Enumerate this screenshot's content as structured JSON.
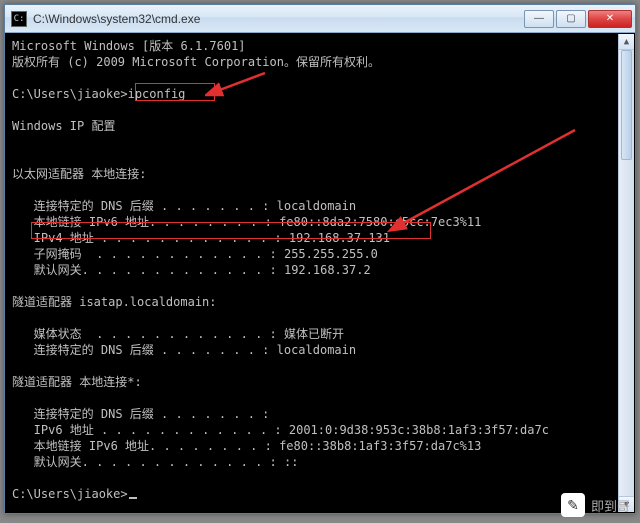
{
  "window": {
    "title": "C:\\Windows\\system32\\cmd.exe"
  },
  "header": {
    "line1": "Microsoft Windows [版本 6.1.7601]",
    "line2": "版权所有 (c) 2009 Microsoft Corporation。保留所有权利。"
  },
  "prompt1": {
    "path": "C:\\Users\\jiaoke>",
    "command": "ipconfig"
  },
  "output": {
    "heading": "Windows IP 配置",
    "sections": [
      {
        "title": "以太网适配器 本地连接:",
        "rows": [
          {
            "label": "   连接特定的 DNS 后缀 . . . . . . . :",
            "value": " localdomain"
          },
          {
            "label": "   本地链接 IPv6 地址. . . . . . . . :",
            "value": " fe80::8da2:7580:c5cc:7ec3%11"
          },
          {
            "label": "   IPv4 地址 . . . . . . . . . . . . :",
            "value": " 192.168.37.131"
          },
          {
            "label": "   子网掩码  . . . . . . . . . . . . :",
            "value": " 255.255.255.0"
          },
          {
            "label": "   默认网关. . . . . . . . . . . . . :",
            "value": " 192.168.37.2"
          }
        ]
      },
      {
        "title": "隧道适配器 isatap.localdomain:",
        "rows": [
          {
            "label": "   媒体状态  . . . . . . . . . . . . :",
            "value": " 媒体已断开"
          },
          {
            "label": "   连接特定的 DNS 后缀 . . . . . . . :",
            "value": " localdomain"
          }
        ]
      },
      {
        "title": "隧道适配器 本地连接*:",
        "rows": [
          {
            "label": "   连接特定的 DNS 后缀 . . . . . . . :",
            "value": ""
          },
          {
            "label": "   IPv6 地址 . . . . . . . . . . . . :",
            "value": " 2001:0:9d38:953c:38b8:1af3:3f57:da7c"
          },
          {
            "label": "   本地链接 IPv6 地址. . . . . . . . :",
            "value": " fe80::38b8:1af3:3f57:da7c%13"
          },
          {
            "label": "   默认网关. . . . . . . . . . . . . :",
            "value": " ::"
          }
        ]
      }
    ]
  },
  "prompt2": {
    "path": "C:\\Users\\jiaoke>"
  },
  "watermark": {
    "text": "即到哥"
  },
  "annotations": {
    "highlight_command": "ipconfig",
    "highlight_ipv4": "IPv4 地址 : 192.168.37.131"
  }
}
